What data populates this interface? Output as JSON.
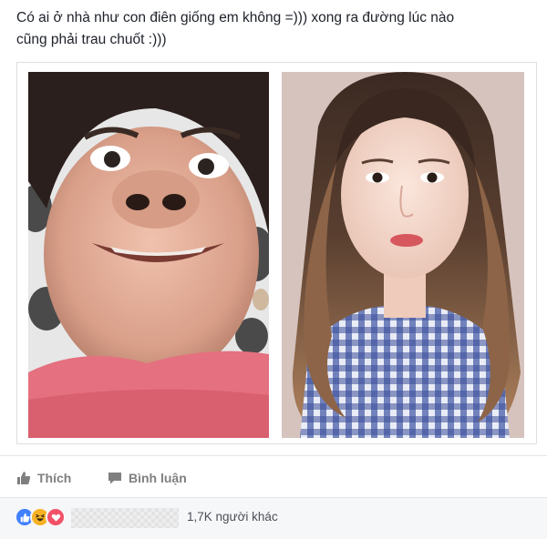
{
  "post": {
    "text": "Có ai ở nhà như con điên giống em không =))) xong ra đường lúc nào\ncũng phải trau chuốt :)))"
  },
  "photos": [
    {
      "name": "photo-funny-face"
    },
    {
      "name": "photo-dressed-up"
    }
  ],
  "actions": {
    "like_label": "Thích",
    "comment_label": "Bình luận"
  },
  "reactions": {
    "icons": [
      "like-icon",
      "haha-icon",
      "love-icon"
    ],
    "count_text": "1,7K người khác"
  },
  "colors": {
    "like": "#4080ff",
    "haha": "#f7b125",
    "love": "#f25268",
    "action_text": "#7f7f7f"
  }
}
